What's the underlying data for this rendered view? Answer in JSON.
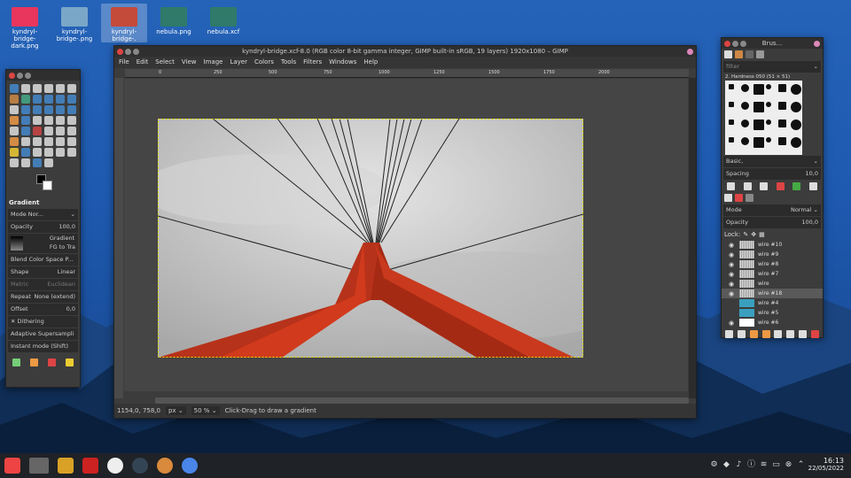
{
  "desktop": {
    "icons": [
      {
        "label": "kyndryl-bridge-dark.png",
        "color": "#e8365d"
      },
      {
        "label": "kyndryl-bridge-.png",
        "color": "#7aa7c7"
      },
      {
        "label": "kyndryl-bridge-.",
        "color": "#c44a3a"
      },
      {
        "label": "nebula.png",
        "color": "#2f7a6a"
      },
      {
        "label": "nebula.xcf",
        "color": "#2f7a6a"
      }
    ]
  },
  "toolbox": {
    "tool_options_title": "Gradient",
    "mode_label": "Mode Nor...",
    "opacity_label": "Opacity",
    "opacity_value": "100,0",
    "gradient_label": "Gradient",
    "gradient_value": "FG to Tra",
    "blend_space": "Blend Color Space P...",
    "shape_label": "Shape",
    "shape_value": "Linear",
    "metric_label": "Metric",
    "metric_value": "Euclidean",
    "repeat_label": "Repeat",
    "repeat_value": "None (extend)",
    "offset_label": "Offset",
    "offset_value": "0,0",
    "dithering": "Dithering",
    "adaptive": "Adaptive Supersampli",
    "instant": "Instant mode (Shift)"
  },
  "gimp": {
    "title": "kyndryl-bridge.xcf-8.0 (RGB color 8-bit gamma integer, GIMP built-in sRGB, 19 layers) 1920x1080 – GIMP",
    "menu": [
      "File",
      "Edit",
      "Select",
      "View",
      "Image",
      "Layer",
      "Colors",
      "Tools",
      "Filters",
      "Windows",
      "Help"
    ],
    "ruler_ticks": [
      "0",
      "250",
      "500",
      "750",
      "1000",
      "1250",
      "1500",
      "1750",
      "2000"
    ],
    "status": {
      "coords": "1154,0, 758,0",
      "unit": "px",
      "zoom": "50 %",
      "message": "Click-Drag to draw a gradient"
    }
  },
  "dock": {
    "title": "Brus...",
    "filter_placeholder": "filter",
    "brush_name": "2. Hardness 050 (51 × 51)",
    "preset": "Basic,",
    "spacing_label": "Spacing",
    "spacing_value": "10,0",
    "mode_label": "Mode",
    "mode_value": "Normal",
    "opacity_label": "Opacity",
    "opacity_value": "100,0",
    "lock_label": "Lock:",
    "layers": [
      {
        "name": "wire #10",
        "visible": true
      },
      {
        "name": "wire #9",
        "visible": true
      },
      {
        "name": "wire #8",
        "visible": true
      },
      {
        "name": "wire #7",
        "visible": true
      },
      {
        "name": "wire",
        "visible": true
      },
      {
        "name": "wire #18",
        "visible": true
      },
      {
        "name": "wire #4",
        "visible": false
      },
      {
        "name": "wire #5",
        "visible": false
      },
      {
        "name": "wire #6",
        "visible": true
      }
    ]
  },
  "taskbar": {
    "time": "16:13",
    "date": "22/05/2022"
  },
  "colors": {
    "accent_red": "#d13a1c",
    "canvas_grey": "#cfcfcf"
  }
}
